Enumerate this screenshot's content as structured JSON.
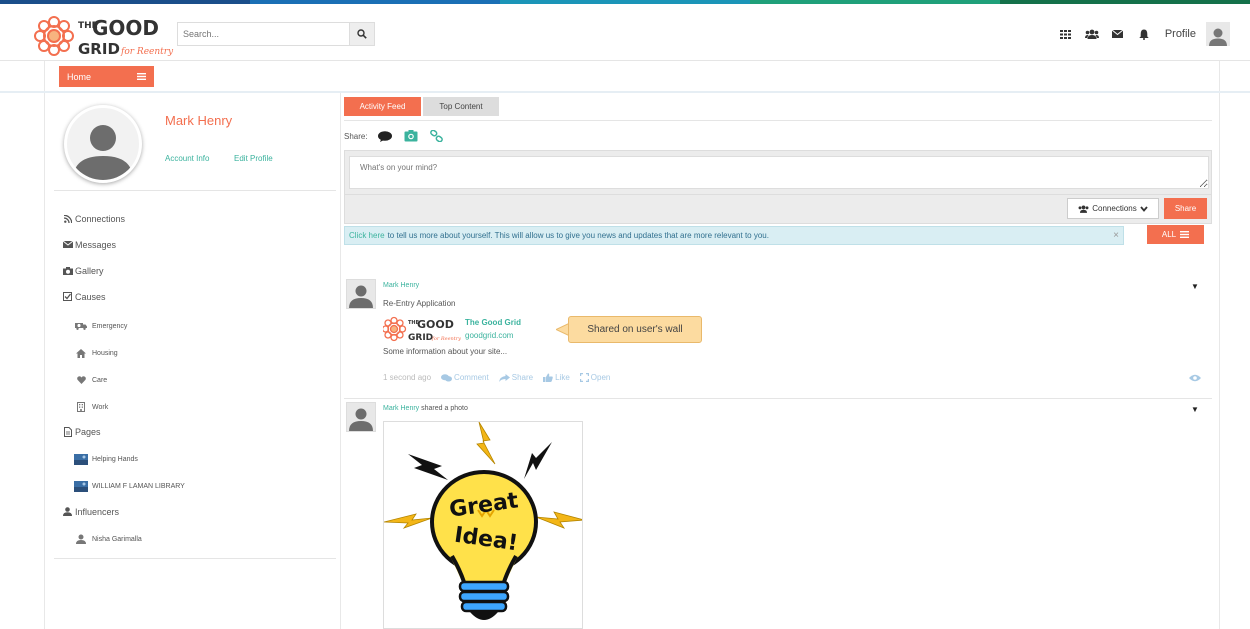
{
  "colors": {
    "accent": "#f36f4f",
    "teal": "#3bb39e",
    "info_bg": "#d9eef3",
    "strip": [
      "#1a4e8a",
      "#1a6fb5",
      "#1b95b8",
      "#1fa07a",
      "#15714a"
    ]
  },
  "header": {
    "search_placeholder": "Search...",
    "profile_label": "Profile",
    "icons": [
      "grid-icon",
      "users-icon",
      "envelope-icon",
      "bell-icon"
    ]
  },
  "logo": {
    "line1": "THE",
    "line2": "GOOD",
    "line3": "GRID",
    "tagline": "for Reentry"
  },
  "subbar": {
    "home_label": "Home"
  },
  "sidebar": {
    "user_name": "Mark Henry",
    "account_info": "Account Info",
    "edit_profile": "Edit Profile",
    "nav": [
      {
        "label": "Connections",
        "icon": "rss-icon"
      },
      {
        "label": "Messages",
        "icon": "envelope-icon"
      },
      {
        "label": "Gallery",
        "icon": "camera-icon"
      },
      {
        "label": "Causes",
        "icon": "check-square-icon"
      },
      {
        "label": "Pages",
        "icon": "file-icon"
      },
      {
        "label": "Influencers",
        "icon": "user-icon"
      }
    ],
    "causes": [
      "Emergency",
      "Housing",
      "Care",
      "Work"
    ],
    "pages": [
      "Helping Hands",
      "WILLIAM F LAMAN LIBRARY"
    ],
    "influencers": [
      "Nisha Garimalla"
    ]
  },
  "tabs": {
    "active": "Activity Feed",
    "other": "Top Content"
  },
  "composer": {
    "share_label": "Share:",
    "placeholder": "What's on your mind?",
    "connections_label": "Connections",
    "share_button": "Share"
  },
  "info": {
    "link": "Click here",
    "text": "to tell us more about yourself. This will allow us to give you news and updates that are more relevant to you.",
    "close": "×"
  },
  "filter": {
    "label": "ALL"
  },
  "feed": [
    {
      "author": "Mark Henry",
      "title": "Re-Entry Application",
      "link_title": "The Good Grid",
      "link_domain": "goodgrid.com",
      "description": "Some information about your site...",
      "time": "1 second ago",
      "actions": [
        "Comment",
        "Share",
        "Like",
        "Open"
      ]
    },
    {
      "author": "Mark Henry",
      "verb": "shared a photo"
    }
  ],
  "callout": "Shared on user's wall",
  "photo_text": [
    "Great",
    "Idea!"
  ]
}
